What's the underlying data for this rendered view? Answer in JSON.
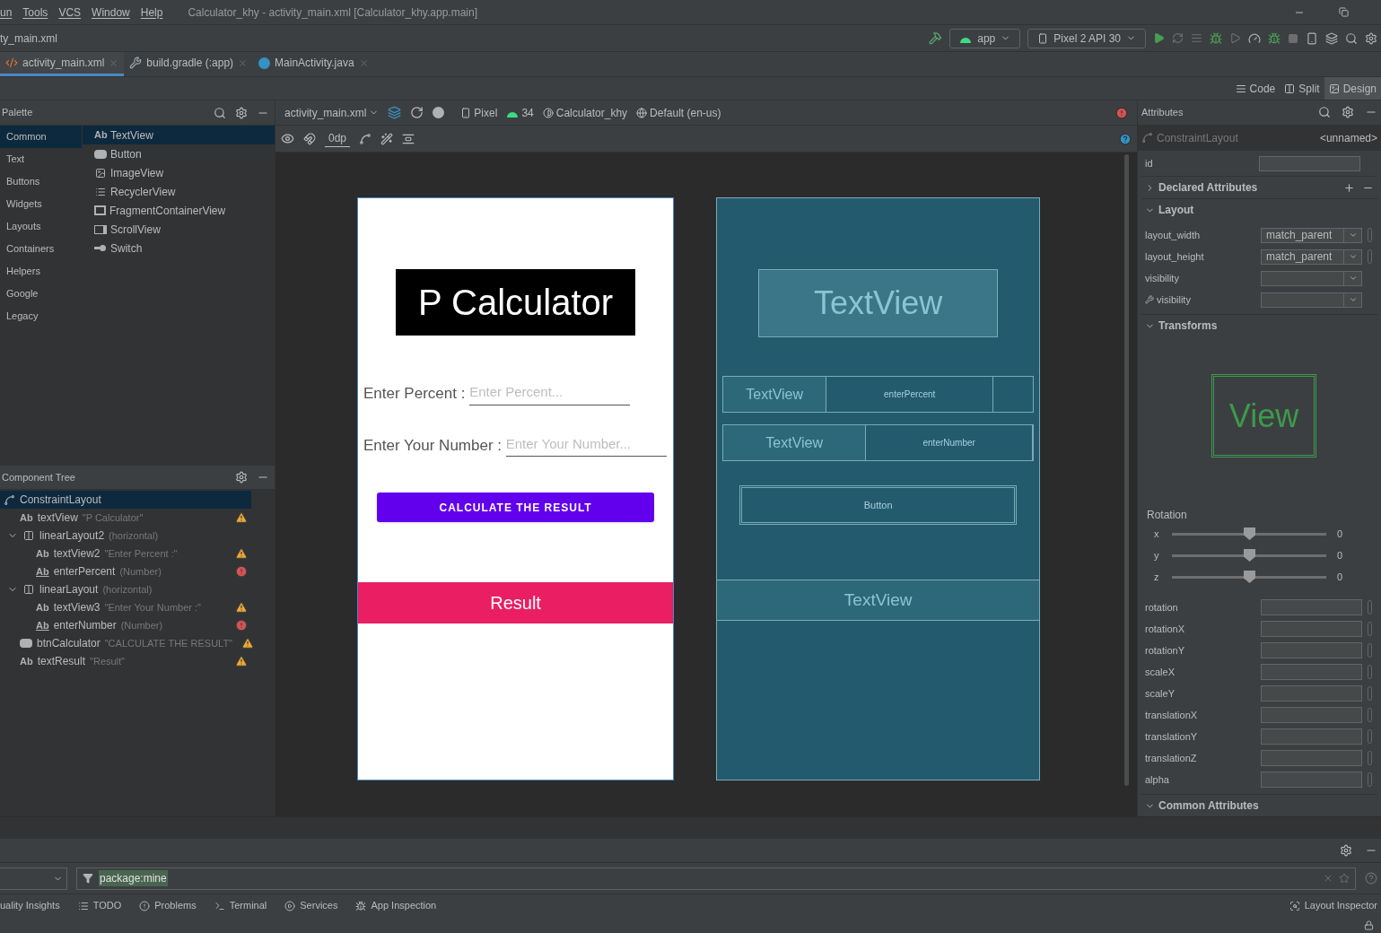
{
  "menu": [
    {
      "label": "un"
    },
    {
      "label": "Tools"
    },
    {
      "label": "VCS"
    },
    {
      "label": "Window"
    },
    {
      "label": "Help"
    }
  ],
  "window_title": "Calculator_khy - activity_main.xml [Calculator_khy.app.main]",
  "breadcrumb": "ty_main.xml",
  "run_config": "app",
  "device": "Pixel 2 API 30",
  "file_tabs": [
    {
      "label": "activity_main.xml",
      "kind": "xml",
      "selected": true
    },
    {
      "label": "build.gradle (:app)",
      "kind": "gradle",
      "selected": false
    },
    {
      "label": "MainActivity.java",
      "kind": "java",
      "selected": false
    }
  ],
  "view_modes": [
    {
      "label": "Code",
      "kind": "code",
      "selected": false
    },
    {
      "label": "Split",
      "kind": "split",
      "selected": false
    },
    {
      "label": "Design",
      "kind": "design",
      "selected": true
    }
  ],
  "palette": {
    "title": "Palette",
    "categories": [
      {
        "label": "Common",
        "selected": true
      },
      {
        "label": "Text",
        "selected": false
      },
      {
        "label": "Buttons",
        "selected": false
      },
      {
        "label": "Widgets",
        "selected": false
      },
      {
        "label": "Layouts",
        "selected": false
      },
      {
        "label": "Containers",
        "selected": false
      },
      {
        "label": "Helpers",
        "selected": false
      },
      {
        "label": "Google",
        "selected": false
      },
      {
        "label": "Legacy",
        "selected": false
      }
    ],
    "items": [
      {
        "label": "TextView",
        "kind": "text",
        "icon": "Ab",
        "selected": true
      },
      {
        "label": "Button",
        "kind": "button",
        "selected": false
      },
      {
        "label": "ImageView",
        "kind": "image",
        "selected": false
      },
      {
        "label": "RecyclerView",
        "kind": "list",
        "selected": false
      },
      {
        "label": "FragmentContainerView",
        "kind": "fragment",
        "selected": false
      },
      {
        "label": "ScrollView",
        "kind": "scroll",
        "selected": false
      },
      {
        "label": "Switch",
        "kind": "switch",
        "selected": false
      }
    ]
  },
  "component_tree": {
    "title": "Component Tree",
    "items": [
      {
        "name": "ConstraintLayout",
        "kind": "constraint",
        "selected": true,
        "children": [
          {
            "name": "textView",
            "detail": "\"P Calculator\"",
            "kind": "text",
            "icon": "Ab",
            "warning": true,
            "selected": false
          },
          {
            "name": "linearLayout2",
            "detail": "(horizontal)",
            "kind": "linear",
            "expanded": true,
            "selected": false,
            "children": [
              {
                "name": "textView2",
                "detail": "\"Enter Percent :\"",
                "kind": "text",
                "icon": "Ab",
                "warning": true,
                "selected": false
              },
              {
                "name": "enterPercent",
                "detail": "(Number)",
                "kind": "edit",
                "icon": "Ab",
                "error": true,
                "selected": false
              }
            ]
          },
          {
            "name": "linearLayout",
            "detail": "(horizontal)",
            "kind": "linear",
            "expanded": true,
            "selected": false,
            "children": [
              {
                "name": "textView3",
                "detail": "\"Enter Your Number :\"",
                "kind": "text",
                "icon": "Ab",
                "warning": true,
                "selected": false
              },
              {
                "name": "enterNumber",
                "detail": "(Number)",
                "kind": "edit",
                "icon": "Ab",
                "error": true,
                "selected": false
              }
            ]
          },
          {
            "name": "btnCalculator",
            "detail": "\"CALCULATE THE RESULT\"",
            "kind": "button",
            "warning": true,
            "selected": false
          },
          {
            "name": "textResult",
            "detail": "\"Result\"",
            "kind": "text",
            "icon": "Ab",
            "warning": true,
            "selected": false
          }
        ]
      }
    ]
  },
  "design_toolbar": {
    "file": "activity_main.xml",
    "device": "Pixel",
    "api": "34",
    "theme": "Calculator_khy",
    "locale": "Default (en-us)",
    "margin": "0dp"
  },
  "preview": {
    "title": "P Calculator",
    "percent_label": "Enter Percent : ",
    "percent_placeholder": "Enter Percent...",
    "number_label": "Enter Your Number : ",
    "number_placeholder": "Enter Your Number...",
    "button": "CALCULATE THE RESULT",
    "result": "Result"
  },
  "blueprint": {
    "title": "TextView",
    "rows": [
      {
        "label": "TextView",
        "field": "enterPercent"
      },
      {
        "label": "TextView",
        "field": "enterNumber"
      }
    ],
    "button": "Button",
    "result": "TextView"
  },
  "attributes": {
    "title": "Attributes",
    "component": "ConstraintLayout",
    "component_id": "<unnamed>",
    "id_label": "id",
    "declared": {
      "title": "Declared Attributes",
      "expanded": false
    },
    "layout": {
      "title": "Layout",
      "expanded": true,
      "rows": [
        {
          "label": "layout_width",
          "value": "match_parent",
          "tool": false
        },
        {
          "label": "layout_height",
          "value": "match_parent",
          "tool": false
        },
        {
          "label": "visibility",
          "tool": false
        },
        {
          "label": "visibility",
          "tool": true
        }
      ]
    },
    "transforms": {
      "title": "Transforms",
      "expanded": true,
      "preview": "View",
      "rotation_title": "Rotation",
      "sliders": [
        {
          "axis": "x",
          "level": 0.5,
          "reading": "0"
        },
        {
          "axis": "y",
          "level": 0.5,
          "reading": "0"
        },
        {
          "axis": "z",
          "level": 0.5,
          "reading": "0"
        }
      ],
      "fields": [
        {
          "label": "rotation"
        },
        {
          "label": "rotationX"
        },
        {
          "label": "rotationY"
        },
        {
          "label": "scaleX"
        },
        {
          "label": "scaleY"
        },
        {
          "label": "translationX"
        },
        {
          "label": "translationY"
        },
        {
          "label": "translationZ"
        },
        {
          "label": "alpha"
        }
      ]
    },
    "common": {
      "title": "Common Attributes",
      "expanded": true
    }
  },
  "logcat_filter": "package:mine",
  "tool_tabs": [
    {
      "label": "uality Insights",
      "kind": "insights"
    },
    {
      "label": "TODO",
      "kind": "todo"
    },
    {
      "label": "Problems",
      "kind": "problems"
    },
    {
      "label": "Terminal",
      "kind": "terminal"
    },
    {
      "label": "Services",
      "kind": "services"
    },
    {
      "label": "App Inspection",
      "kind": "inspection"
    }
  ],
  "layout_inspector": "Layout Inspector"
}
